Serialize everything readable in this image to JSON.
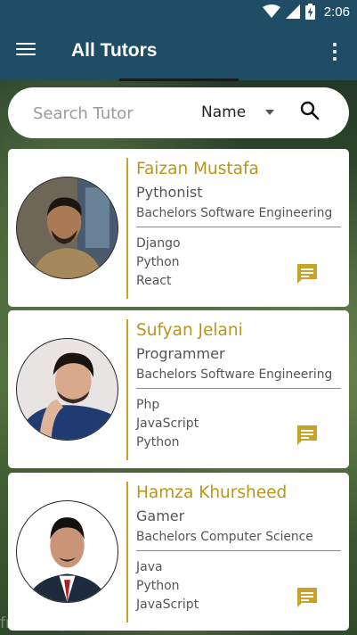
{
  "status_bar": {
    "time": "2:06",
    "icons": [
      "wifi-icon",
      "signal-icon",
      "battery-charging-icon"
    ]
  },
  "app_bar": {
    "title": "All Tutors",
    "menu_icon": "hamburger-menu-icon",
    "overflow_icon": "more-vert-icon"
  },
  "search": {
    "placeholder": "Search Tutor",
    "value": "",
    "sort_value": "Name",
    "search_icon": "search-icon"
  },
  "tutors": [
    {
      "name": "Faizan Mustafa",
      "role": "Pythonist",
      "degree": "Bachelors Software Engineering",
      "skills": [
        "Django",
        "Python",
        "React"
      ]
    },
    {
      "name": "Sufyan Jelani",
      "role": "Programmer",
      "degree": "Bachelors Software Engineering",
      "skills": [
        "Php",
        "JavaScript",
        "Python"
      ]
    },
    {
      "name": "Hamza Khursheed",
      "role": "Gamer",
      "degree": "Bachelors Computer Science",
      "skills": [
        "Java",
        "Python",
        "JavaScript"
      ]
    }
  ],
  "colors": {
    "app_bar": "#1f4d66",
    "accent_gold": "#c9a228",
    "name_text": "#b8961c"
  },
  "watermark": "free for personal use"
}
